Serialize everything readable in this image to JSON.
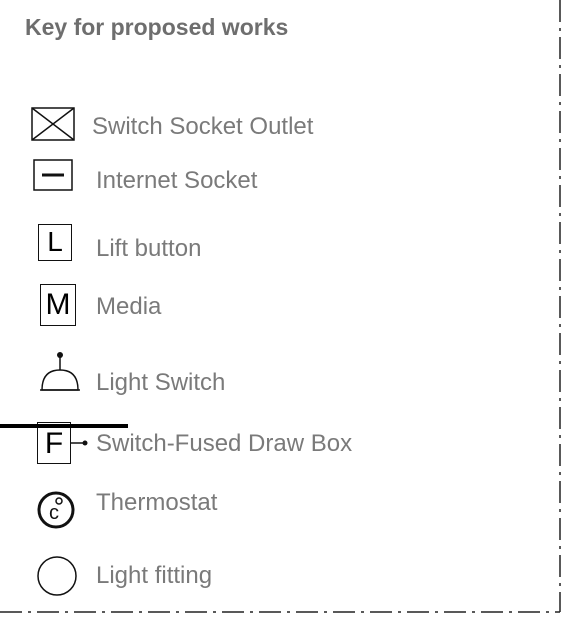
{
  "key": {
    "title": "Key for proposed works",
    "items": [
      {
        "symbol": "switch-socket-icon",
        "label": "Switch Socket Outlet"
      },
      {
        "symbol": "internet-socket-icon",
        "label": "Internet Socket"
      },
      {
        "symbol": "lift-button-icon",
        "letter": "L",
        "label": "Lift button"
      },
      {
        "symbol": "media-icon",
        "letter": "M",
        "label": "Media"
      },
      {
        "symbol": "light-switch-icon",
        "label": "Light Switch"
      },
      {
        "symbol": "fused-draw-box-icon",
        "letter": "F",
        "label": "Switch-Fused Draw Box"
      },
      {
        "symbol": "thermostat-icon",
        "letter": "c",
        "label": "Thermostat"
      },
      {
        "symbol": "light-fitting-icon",
        "label": "Light fitting"
      }
    ]
  }
}
